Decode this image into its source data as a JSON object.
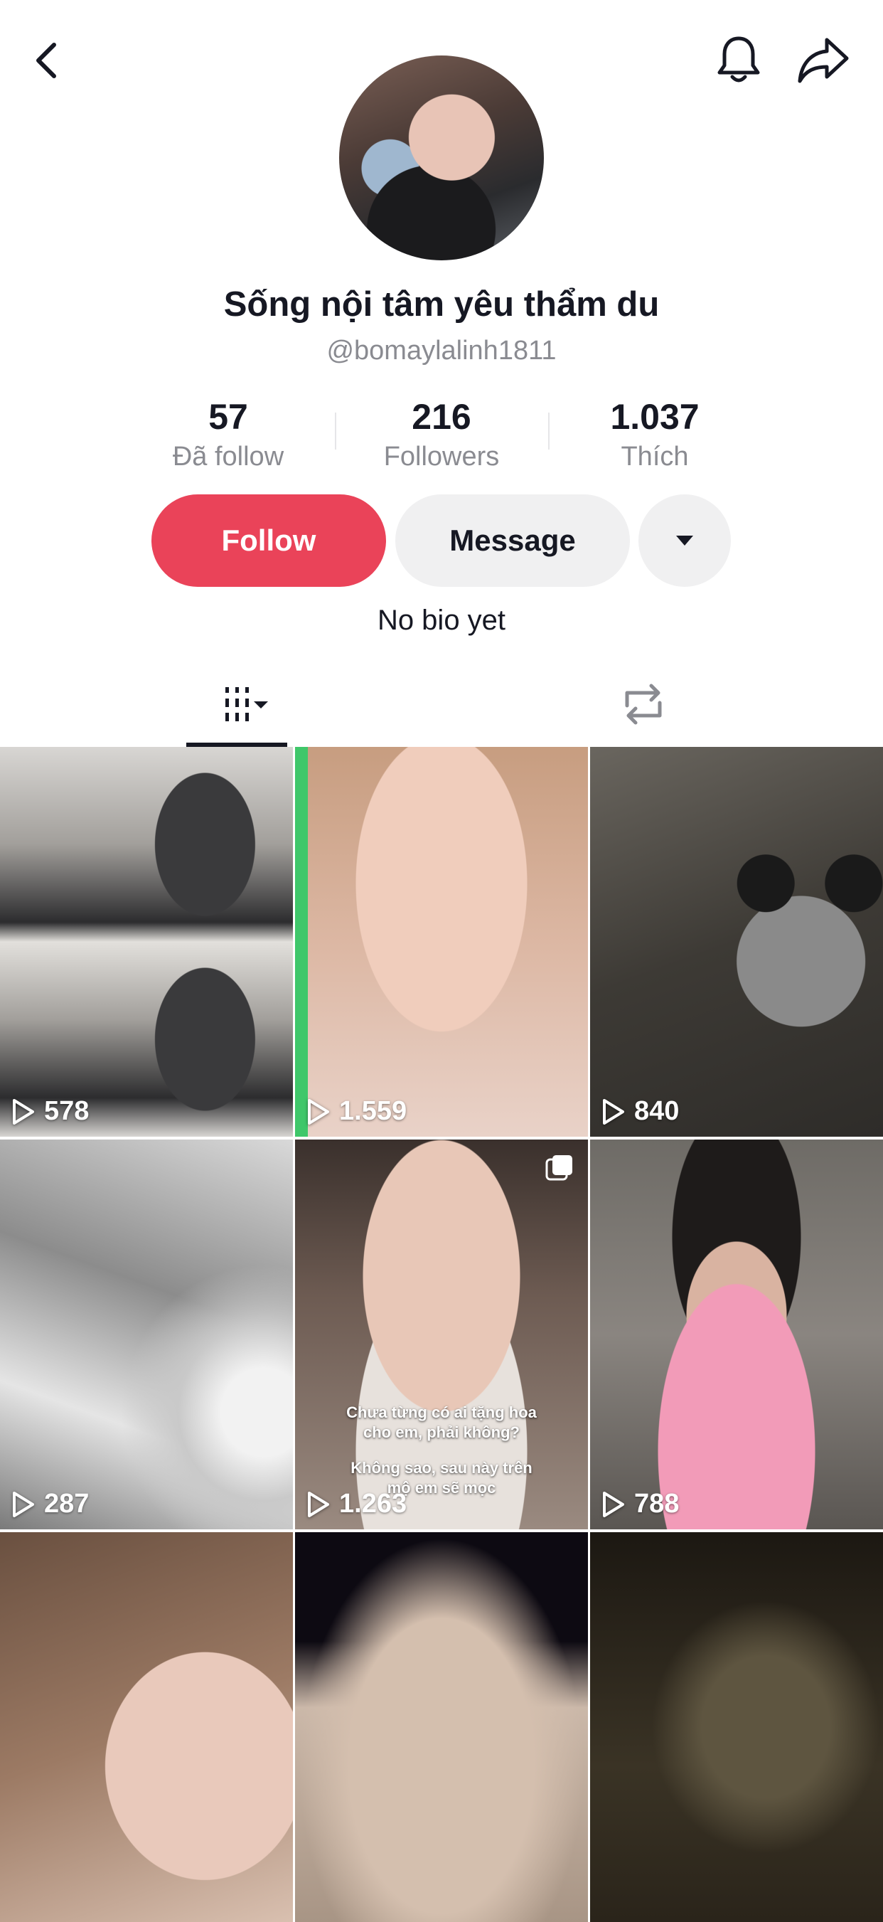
{
  "header": {
    "back_icon": "chevron-left-icon",
    "bell_icon": "bell-icon",
    "share_icon": "share-arrow-icon"
  },
  "profile": {
    "display_name": "Sống nội tâm yêu thẩm du",
    "username": "@bomaylalinh1811",
    "stats": [
      {
        "value": "57",
        "label": "Đã follow"
      },
      {
        "value": "216",
        "label": "Followers"
      },
      {
        "value": "1.037",
        "label": "Thích"
      }
    ],
    "buttons": {
      "follow": "Follow",
      "message": "Message"
    },
    "bio": "No bio yet"
  },
  "tabs": {
    "videos_icon": "grid-bars-icon",
    "reposts_icon": "repost-icon"
  },
  "videos": [
    {
      "views": "578"
    },
    {
      "views": "1.559"
    },
    {
      "views": "840"
    },
    {
      "views": "287"
    },
    {
      "views": "1.263",
      "overlay_line1": "Chưa từng có ai tặng hoa",
      "overlay_line2": "cho em, phải không?",
      "overlay_line3": "Không sao, sau này trên",
      "overlay_line4": "mộ em sẽ mọc"
    },
    {
      "views": "788"
    },
    {
      "views": ""
    },
    {
      "views": ""
    },
    {
      "views": ""
    }
  ],
  "colors": {
    "follow_button": "#ea4359",
    "secondary_button": "#f0f0f1",
    "muted_text": "#8a8b91"
  }
}
